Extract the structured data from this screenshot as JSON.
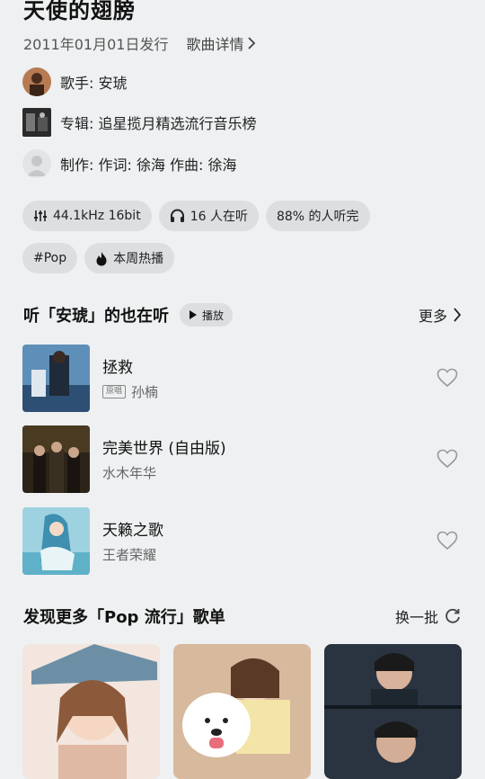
{
  "header": {
    "title": "天使的翅膀",
    "release": "2011年01月01日发行",
    "detail_link": "歌曲详情"
  },
  "info": {
    "singer": "歌手: 安琥",
    "album": "专辑: 追星揽月精选流行音乐榜",
    "credits": "制作: 作词: 徐海 作曲: 徐海"
  },
  "chips": {
    "quality": "44.1kHz 16bit",
    "listening": "16 人在听",
    "completion": "88% 的人听完",
    "genre": "#Pop",
    "hot": "本周热播"
  },
  "also_listening": {
    "title": "听「安琥」的也在听",
    "play_label": "播放",
    "more_label": "更多",
    "songs": [
      {
        "name": "拯救",
        "tag": "原唱",
        "artist": "孙楠"
      },
      {
        "name": "完美世界 (自由版)",
        "artist": "水木年华"
      },
      {
        "name": "天籁之歌",
        "artist": "王者荣耀"
      }
    ]
  },
  "discover": {
    "title": "发现更多「Pop 流行」歌单",
    "refresh_label": "换一批"
  },
  "colors": {
    "background": "#eef0f1",
    "chip": "#dcdee0",
    "hot": "#111111"
  }
}
